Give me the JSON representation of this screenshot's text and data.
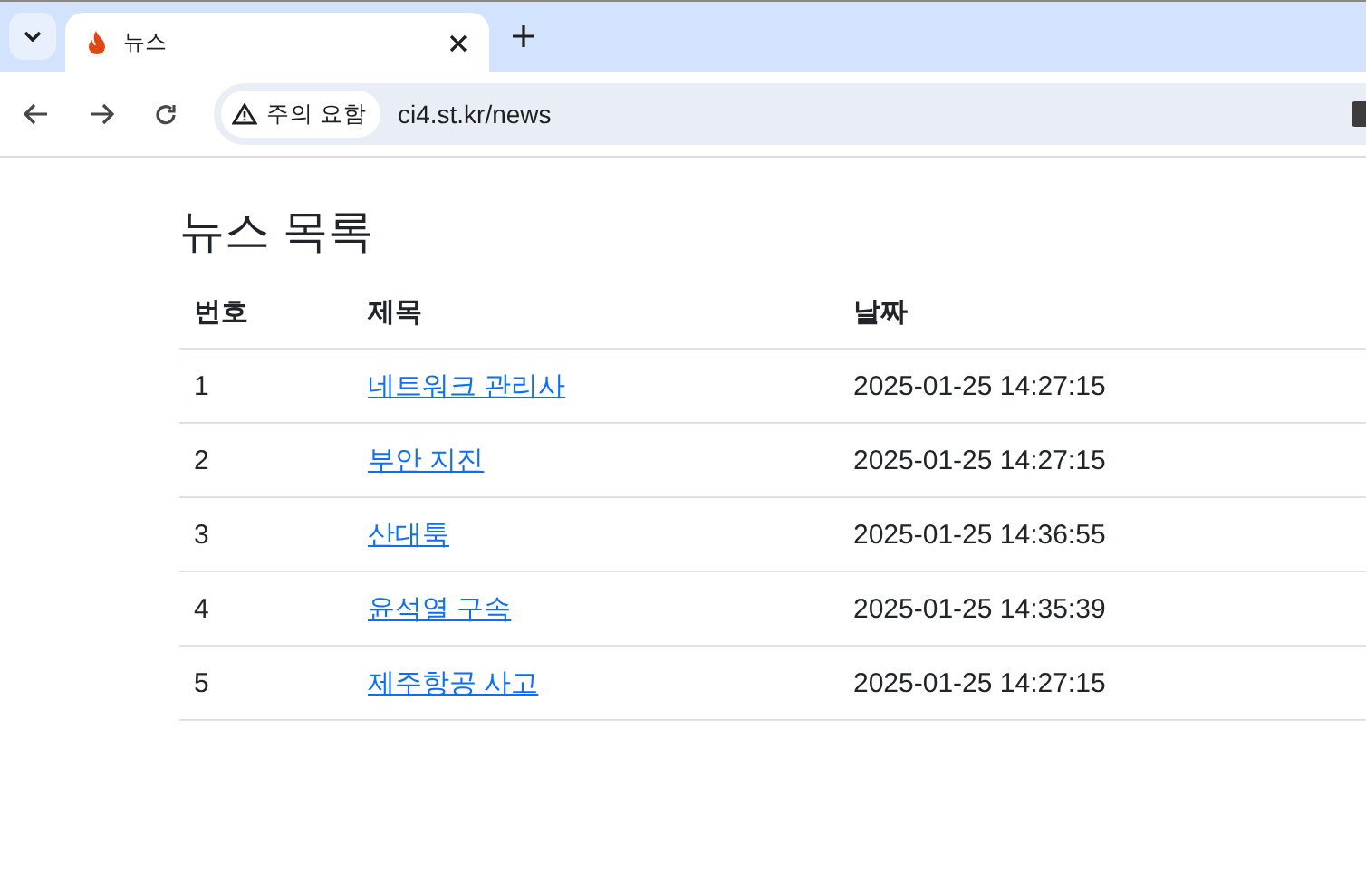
{
  "browser": {
    "tab": {
      "title": "뉴스"
    },
    "security": "주의 요함",
    "url": "ci4.st.kr/news"
  },
  "page": {
    "heading": "뉴스 목록",
    "table": {
      "columns": [
        "번호",
        "제목",
        "날짜"
      ],
      "rows": [
        {
          "number": "1",
          "title": "네트워크 관리사",
          "date": "2025-01-25 14:27:15"
        },
        {
          "number": "2",
          "title": "부안 지진",
          "date": "2025-01-25 14:27:15"
        },
        {
          "number": "3",
          "title": "산대툭",
          "date": "2025-01-25 14:36:55"
        },
        {
          "number": "4",
          "title": "윤석열 구속",
          "date": "2025-01-25 14:35:39"
        },
        {
          "number": "5",
          "title": "제주항공 사고",
          "date": "2025-01-25 14:27:15"
        }
      ]
    }
  }
}
